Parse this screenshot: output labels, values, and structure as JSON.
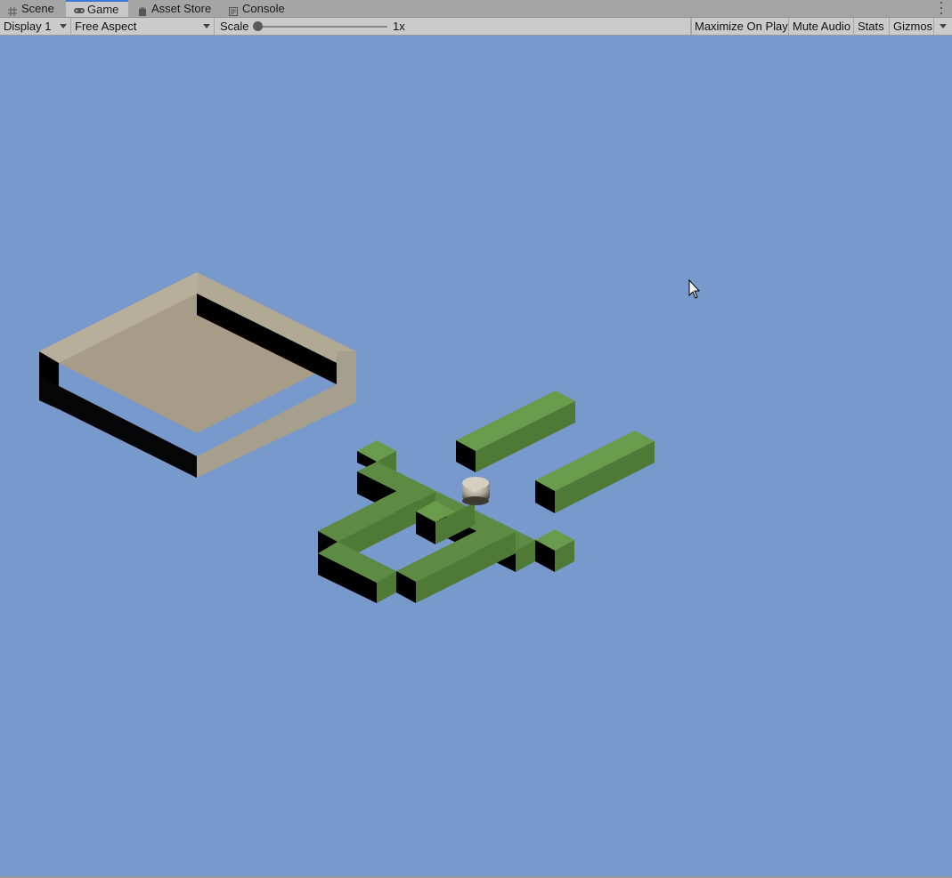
{
  "tabs": [
    {
      "label": "Scene",
      "icon": "grid-icon"
    },
    {
      "label": "Game",
      "icon": "gamepad-icon"
    },
    {
      "label": "Asset Store",
      "icon": "bag-icon"
    },
    {
      "label": "Console",
      "icon": "console-icon"
    }
  ],
  "toolbar": {
    "display": "Display 1",
    "aspect": "Free Aspect",
    "scale_label": "Scale",
    "scale_value": "1x",
    "maximize": "Maximize On Play",
    "mute": "Mute Audio",
    "stats": "Stats",
    "gizmos": "Gizmos"
  },
  "colors": {
    "sky": "#7799cc",
    "platform_top": "#a69c88",
    "platform_side": "#8a8170",
    "maze_top": "#5e8b43",
    "maze_side": "#4f7a36",
    "shadow": "#000000",
    "ball": "#b9b4a4"
  }
}
